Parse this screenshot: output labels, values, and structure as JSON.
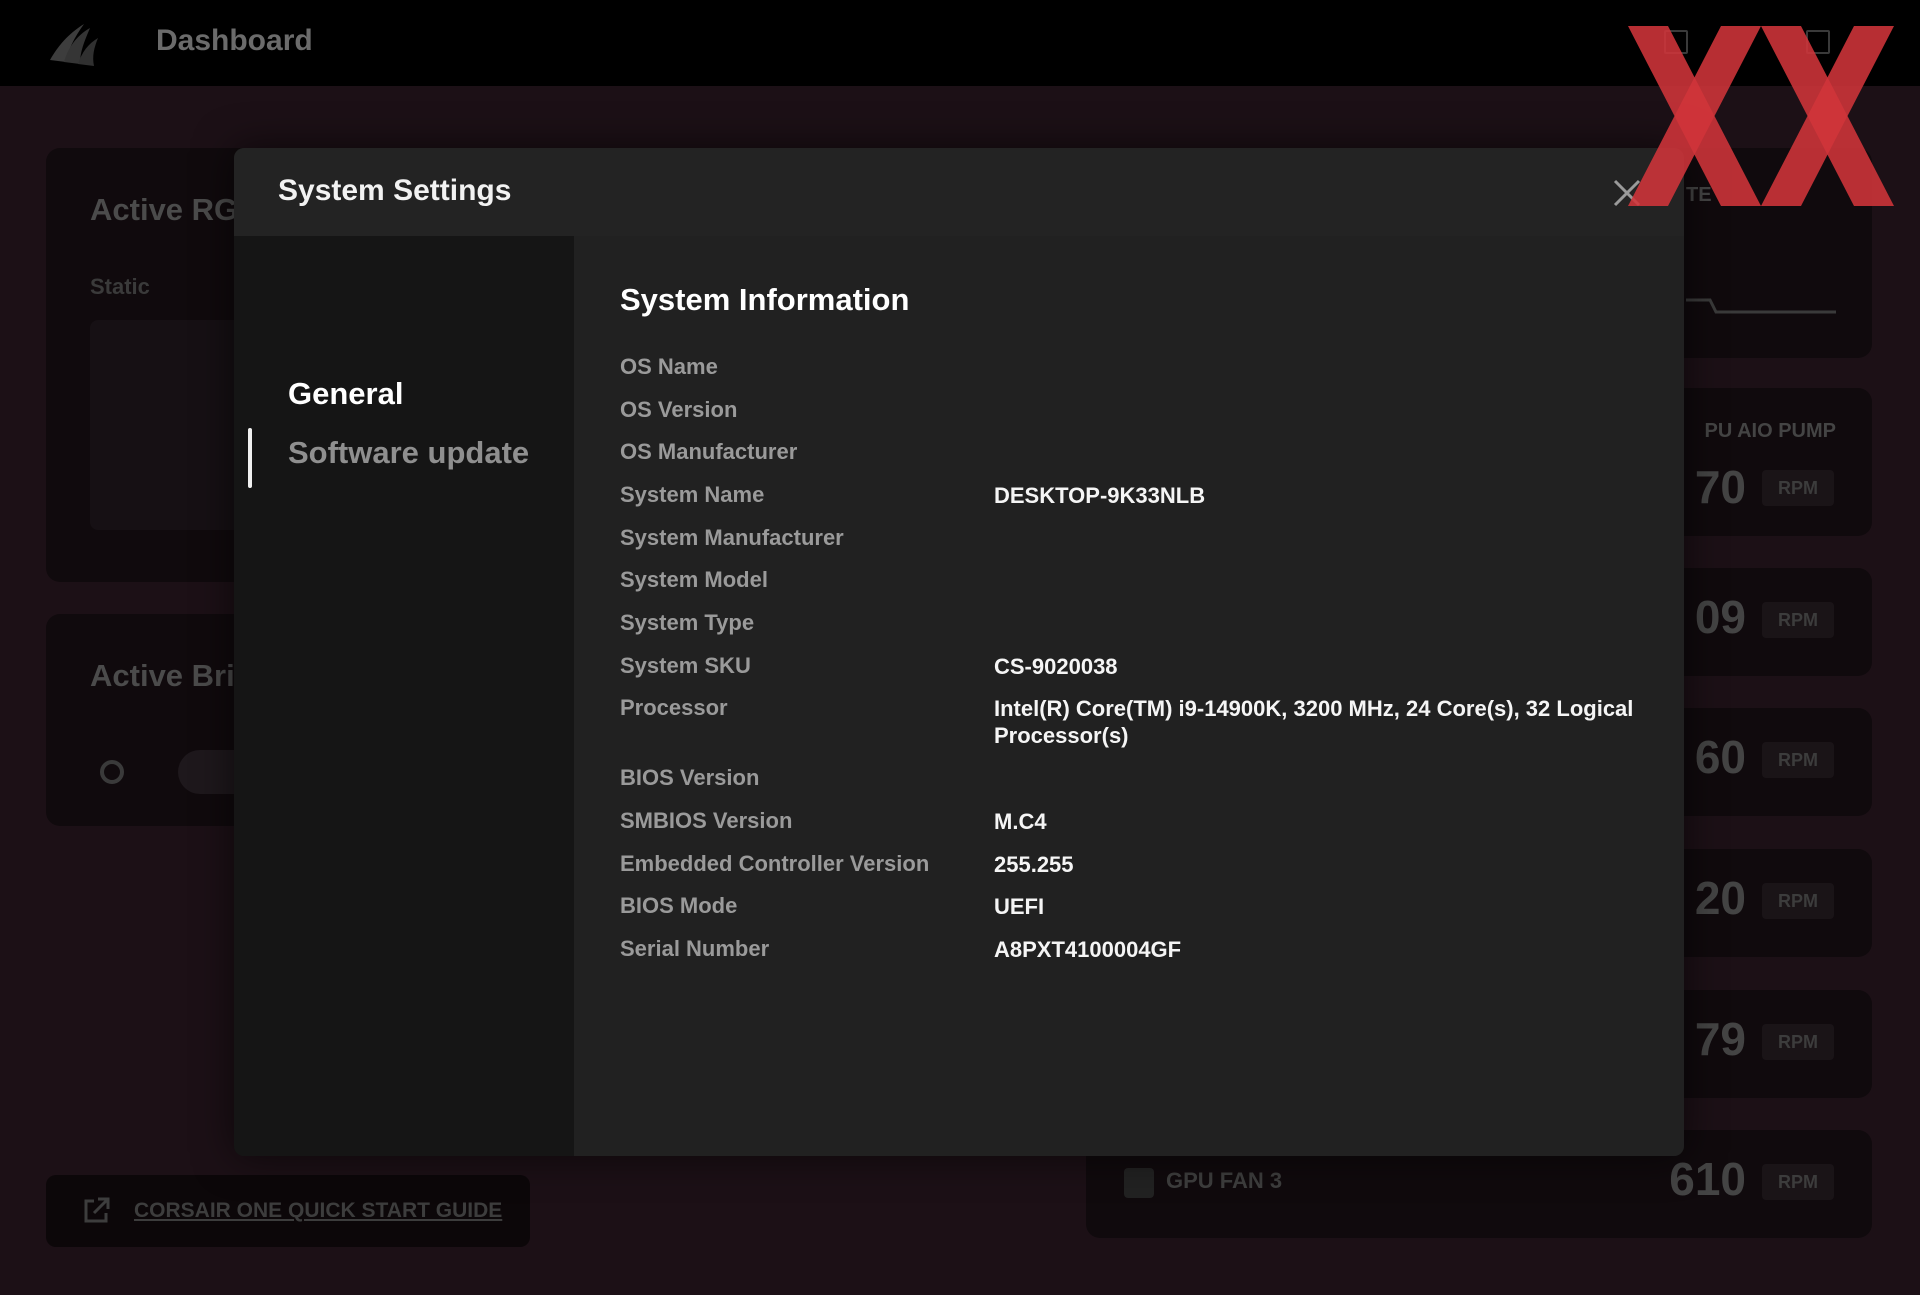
{
  "app": {
    "title": "Dashboard",
    "accent_color": "#d0343a",
    "icons": [
      "corsair-sails-icon",
      "minimize-icon",
      "maximize-icon"
    ]
  },
  "background": {
    "cards": {
      "active_rgb_title": "Active RG",
      "active_rgb_mode": "Static",
      "active_brightness_title": "Active Bri"
    },
    "guide_link": "CORSAIR ONE QUICK START GUIDE",
    "temp_label": "TE",
    "pump_label": "PU AIO PUMP",
    "fans": [
      {
        "name": "",
        "value": "70",
        "unit": "RPM"
      },
      {
        "name": "",
        "value": "09",
        "unit": "RPM"
      },
      {
        "name": "",
        "value": "60",
        "unit": "RPM"
      },
      {
        "name": "",
        "value": "20",
        "unit": "RPM"
      },
      {
        "name": "",
        "value": "79",
        "unit": "RPM"
      },
      {
        "name": "GPU FAN 3",
        "value": "610",
        "unit": "RPM"
      }
    ]
  },
  "modal": {
    "title": "System Settings",
    "nav": {
      "general": "General",
      "software_update": "Software update"
    },
    "section_title": "System Information",
    "rows": [
      {
        "label": "OS Name",
        "value": ""
      },
      {
        "label": "OS Version",
        "value": ""
      },
      {
        "label": "OS Manufacturer",
        "value": ""
      },
      {
        "label": "System Name",
        "value": "DESKTOP-9K33NLB"
      },
      {
        "label": "System Manufacturer",
        "value": ""
      },
      {
        "label": "System Model",
        "value": ""
      },
      {
        "label": "System Type",
        "value": ""
      },
      {
        "label": "System SKU",
        "value": "CS-9020038"
      },
      {
        "label": "Processor",
        "value": "Intel(R) Core(TM) i9-14900K, 3200 MHz, 24 Core(s), 32 Logical Processor(s)"
      },
      {
        "label": "BIOS Version",
        "value": ""
      },
      {
        "label": "SMBIOS Version",
        "value": "M.C4"
      },
      {
        "label": "Embedded Controller Version",
        "value": "255.255"
      },
      {
        "label": "BIOS Mode",
        "value": "UEFI"
      },
      {
        "label": "Serial Number",
        "value": "A8PXT4100004GF"
      }
    ]
  }
}
